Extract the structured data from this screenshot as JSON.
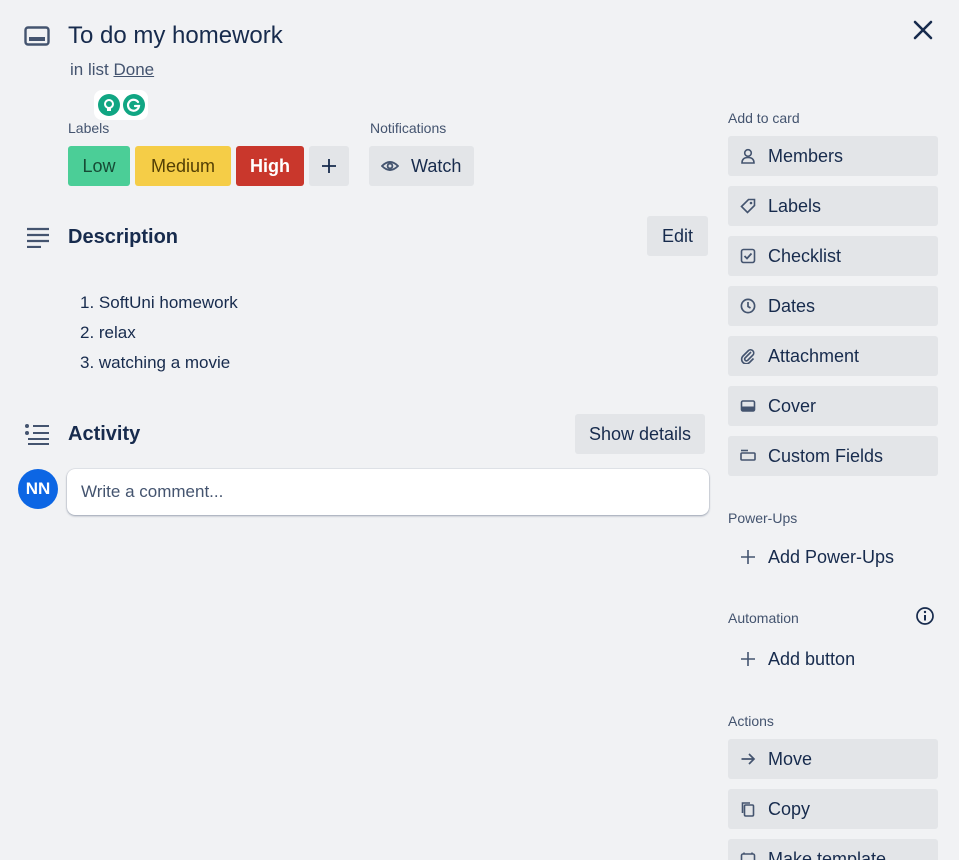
{
  "card": {
    "title": "To do my homework",
    "in_list_prefix": "in list",
    "list_name": "Done"
  },
  "labels": {
    "heading": "Labels",
    "items": [
      {
        "text": "Low",
        "color": "#4bce97"
      },
      {
        "text": "Medium",
        "color": "#f5cd47"
      },
      {
        "text": "High",
        "color": "#c9372c"
      }
    ],
    "add_icon": "plus-icon"
  },
  "notifications": {
    "heading": "Notifications",
    "watch_label": "Watch",
    "watch_icon": "eye-icon"
  },
  "description": {
    "title": "Description",
    "edit_label": "Edit",
    "items": [
      "1. SoftUni homework",
      "2. relax",
      "3. watching a movie"
    ]
  },
  "activity": {
    "title": "Activity",
    "show_details_label": "Show details",
    "avatar_initials": "NN",
    "comment_placeholder": "Write a comment..."
  },
  "sidebar": {
    "add_to_card_heading": "Add to card",
    "add_to_card": [
      {
        "label": "Members",
        "icon": "person-icon"
      },
      {
        "label": "Labels",
        "icon": "tag-icon"
      },
      {
        "label": "Checklist",
        "icon": "checkbox-icon"
      },
      {
        "label": "Dates",
        "icon": "clock-icon"
      },
      {
        "label": "Attachment",
        "icon": "paperclip-icon"
      },
      {
        "label": "Cover",
        "icon": "card-cover-icon"
      },
      {
        "label": "Custom Fields",
        "icon": "fields-icon"
      }
    ],
    "power_ups_heading": "Power-Ups",
    "add_power_ups_label": "Add Power-Ups",
    "automation_heading": "Automation",
    "add_button_label": "Add button",
    "actions_heading": "Actions",
    "actions": [
      {
        "label": "Move",
        "icon": "arrow-right-icon"
      },
      {
        "label": "Copy",
        "icon": "copy-icon"
      },
      {
        "label": "Make template",
        "icon": "template-icon"
      }
    ]
  },
  "colors": {
    "background": "#f1f2f4",
    "button": "#e3e5e8",
    "text": "#172b4d",
    "subtle_text": "#44546f",
    "avatar": "#0c66e4",
    "extension": "#11a683"
  }
}
